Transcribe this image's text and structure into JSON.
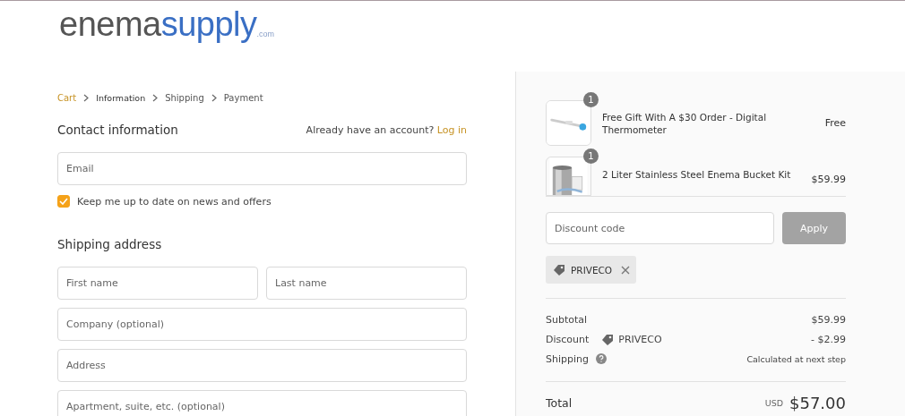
{
  "logo": {
    "part_1": "enema",
    "part_2": "supply",
    "suffix": ".com"
  },
  "breadcrumb": [
    {
      "label": "Cart",
      "kind": "link"
    },
    {
      "label": "Information",
      "kind": "current"
    },
    {
      "label": "Shipping",
      "kind": "step"
    },
    {
      "label": "Payment",
      "kind": "step"
    }
  ],
  "contact": {
    "heading": "Contact information",
    "account_prompt": "Already have an account?",
    "login_link": "Log in",
    "email": {
      "placeholder": "Email"
    },
    "newsletter": {
      "label": "Keep me up to date on news and offers",
      "checked": true
    }
  },
  "shipping_address": {
    "heading": "Shipping address",
    "fields": [
      {
        "placeholder": "First name",
        "kind": "half"
      },
      {
        "placeholder": "Last name",
        "kind": "half"
      },
      {
        "placeholder": "Company (optional)",
        "kind": "full"
      },
      {
        "placeholder": "Address",
        "kind": "full"
      },
      {
        "placeholder": "Apartment, suite, etc. (optional)",
        "kind": "full"
      }
    ]
  },
  "order_summary": {
    "products": [
      {
        "name": "Free Gift With A $30 Order - Digital Thermometer",
        "quantity": "1",
        "price": "Free",
        "kind": "thermometer"
      },
      {
        "name": "2 Liter Stainless Steel Enema Bucket Kit",
        "quantity": "1",
        "price": "$59.99",
        "kind": "bucket"
      }
    ],
    "discount_field": {
      "placeholder": "Discount code"
    },
    "apply_button": {
      "label": "Apply",
      "disabled": true
    },
    "applied_code": "PRIVECO",
    "subtotal": {
      "label": "Subtotal",
      "value": "$59.99"
    },
    "discount": {
      "label": "Discount",
      "code": "PRIVECO",
      "value": "- $2.99"
    },
    "shipping": {
      "label": "Shipping",
      "value": "Calculated at next step"
    },
    "total": {
      "label": "Total",
      "currency": "USD",
      "value": "$57.00"
    }
  }
}
